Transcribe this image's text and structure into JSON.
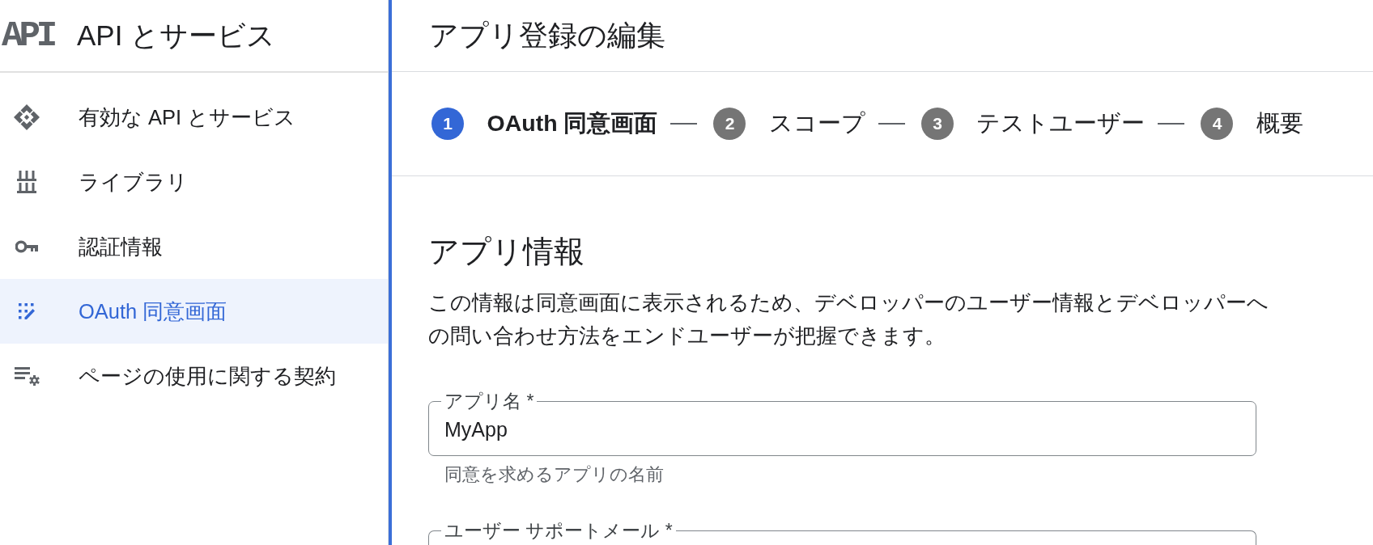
{
  "sidebar": {
    "logo": "API",
    "title": "API とサービス",
    "items": [
      {
        "kind": "apis",
        "label": "有効な API とサービス",
        "selected": false
      },
      {
        "kind": "library",
        "label": "ライブラリ",
        "selected": false
      },
      {
        "kind": "credentials",
        "label": "認証情報",
        "selected": false
      },
      {
        "kind": "consent",
        "label": "OAuth 同意画面",
        "selected": true
      },
      {
        "kind": "agreements",
        "label": "ページの使用に関する契約",
        "selected": false
      }
    ]
  },
  "main": {
    "title": "アプリ登録の編集",
    "steps": [
      {
        "number": "1",
        "label": "OAuth 同意画面",
        "selected": true
      },
      {
        "number": "2",
        "label": "スコープ",
        "selected": false
      },
      {
        "number": "3",
        "label": "テストユーザー",
        "selected": false
      },
      {
        "number": "4",
        "label": "概要",
        "selected": false
      }
    ],
    "section": {
      "heading": "アプリ情報",
      "description": "この情報は同意画面に表示されるため、デベロッパーのユーザー情報とデベロッパーへの問い合わせ方法をエンドユーザーが把握できます。",
      "fields": [
        {
          "label": "アプリ名 *",
          "value": "MyApp",
          "helper": "同意を求めるアプリの名前"
        },
        {
          "label": "ユーザー サポートメール *"
        }
      ]
    }
  }
}
